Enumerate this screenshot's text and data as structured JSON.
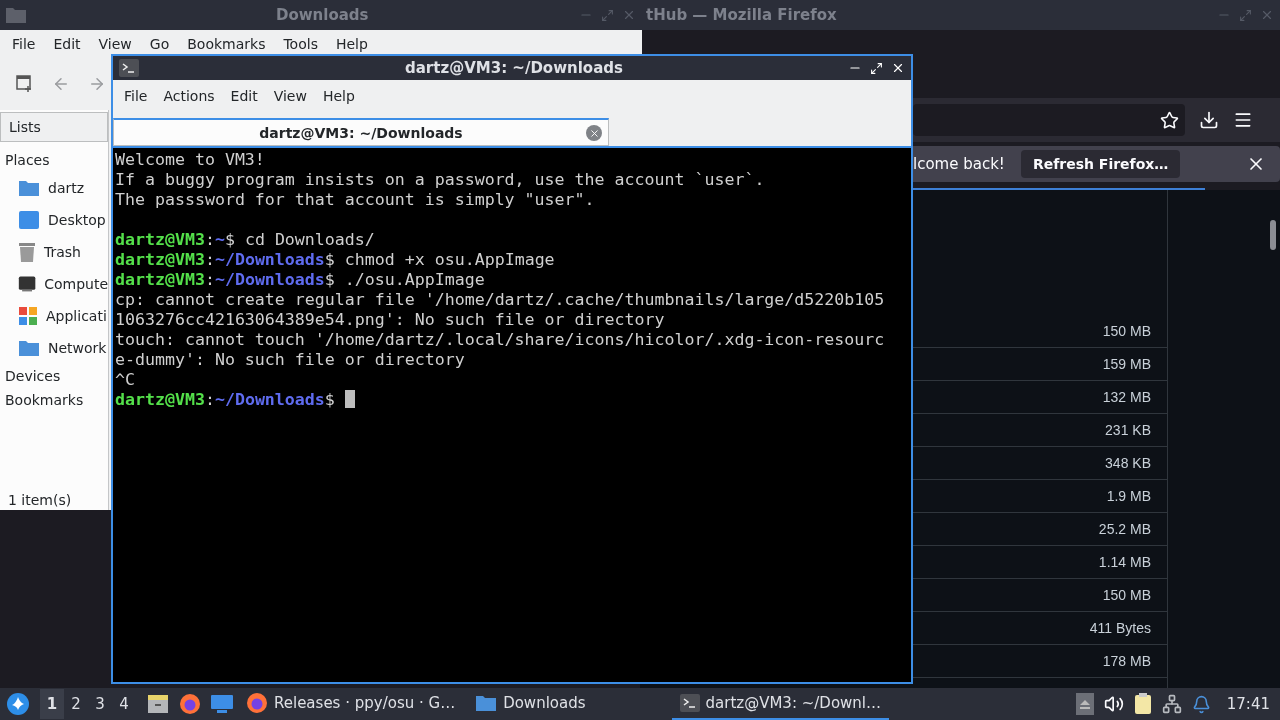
{
  "firefox": {
    "title": "tHub — Mozilla Firefox",
    "notification": {
      "message": "lcome back!",
      "button": "Refresh Firefox…"
    },
    "file_sizes": [
      "150 MB",
      "159 MB",
      "132 MB",
      "231 KB",
      "348 KB",
      "1.9 MB",
      "25.2 MB",
      "1.14 MB",
      "150 MB",
      "411 Bytes",
      "178 MB"
    ]
  },
  "file_manager": {
    "title": "Downloads",
    "menu": [
      "File",
      "Edit",
      "View",
      "Go",
      "Bookmarks",
      "Tools",
      "Help"
    ],
    "panel_tab": "Lists",
    "places": {
      "label": "Places",
      "items": [
        {
          "label": "dartz"
        },
        {
          "label": "Desktop"
        },
        {
          "label": "Trash"
        },
        {
          "label": "Compute"
        },
        {
          "label": "Applicati"
        },
        {
          "label": "Network"
        }
      ]
    },
    "sections": [
      "Devices",
      "Bookmarks"
    ],
    "status": "1 item(s)"
  },
  "terminal": {
    "title": "dartz@VM3: ~/Downloads",
    "menu": [
      "File",
      "Actions",
      "Edit",
      "View",
      "Help"
    ],
    "tabs": [
      {
        "label": "dartz@VM3: ~/Downloads",
        "selected": true
      }
    ],
    "lines": [
      {
        "kind": "output",
        "text": "Welcome to VM3!"
      },
      {
        "kind": "output",
        "text": "If a buggy program insists on a password, use the account `user`."
      },
      {
        "kind": "output",
        "text": "The passsword for that account is simply \"user\"."
      },
      {
        "kind": "blank"
      },
      {
        "kind": "prompt",
        "user": "dartz@VM3",
        "separator": ":",
        "path": "~",
        "symbol": "$",
        "command": " cd Downloads/",
        "cursor": false
      },
      {
        "kind": "prompt",
        "user": "dartz@VM3",
        "separator": ":",
        "path": "~/Downloads",
        "symbol": "$",
        "command": " chmod +x osu.AppImage",
        "cursor": false
      },
      {
        "kind": "prompt",
        "user": "dartz@VM3",
        "separator": ":",
        "path": "~/Downloads",
        "symbol": "$",
        "command": " ./osu.AppImage",
        "cursor": false
      },
      {
        "kind": "output",
        "text": "cp: cannot create regular file '/home/dartz/.cache/thumbnails/large/d5220b105"
      },
      {
        "kind": "output",
        "text": "1063276cc42163064389e54.png': No such file or directory"
      },
      {
        "kind": "output",
        "text": "touch: cannot touch '/home/dartz/.local/share/icons/hicolor/.xdg-icon-resourc"
      },
      {
        "kind": "output",
        "text": "e-dummy': No such file or directory"
      },
      {
        "kind": "output",
        "text": "^C"
      },
      {
        "kind": "prompt",
        "user": "dartz@VM3",
        "separator": ":",
        "path": "~/Downloads",
        "symbol": "$",
        "cursor": true
      }
    ]
  },
  "taskbar": {
    "workspaces": [
      {
        "label": "1",
        "selected": true
      },
      {
        "label": "2",
        "selected": false
      },
      {
        "label": "3",
        "selected": false
      },
      {
        "label": "4",
        "selected": false
      }
    ],
    "tasks": [
      {
        "label": "Releases · ppy/osu · G…",
        "selected": false
      },
      {
        "label": "Downloads",
        "selected": false
      },
      {
        "label": "dartz@VM3: ~/Downl…",
        "selected": true
      }
    ],
    "clock": "17:41"
  }
}
